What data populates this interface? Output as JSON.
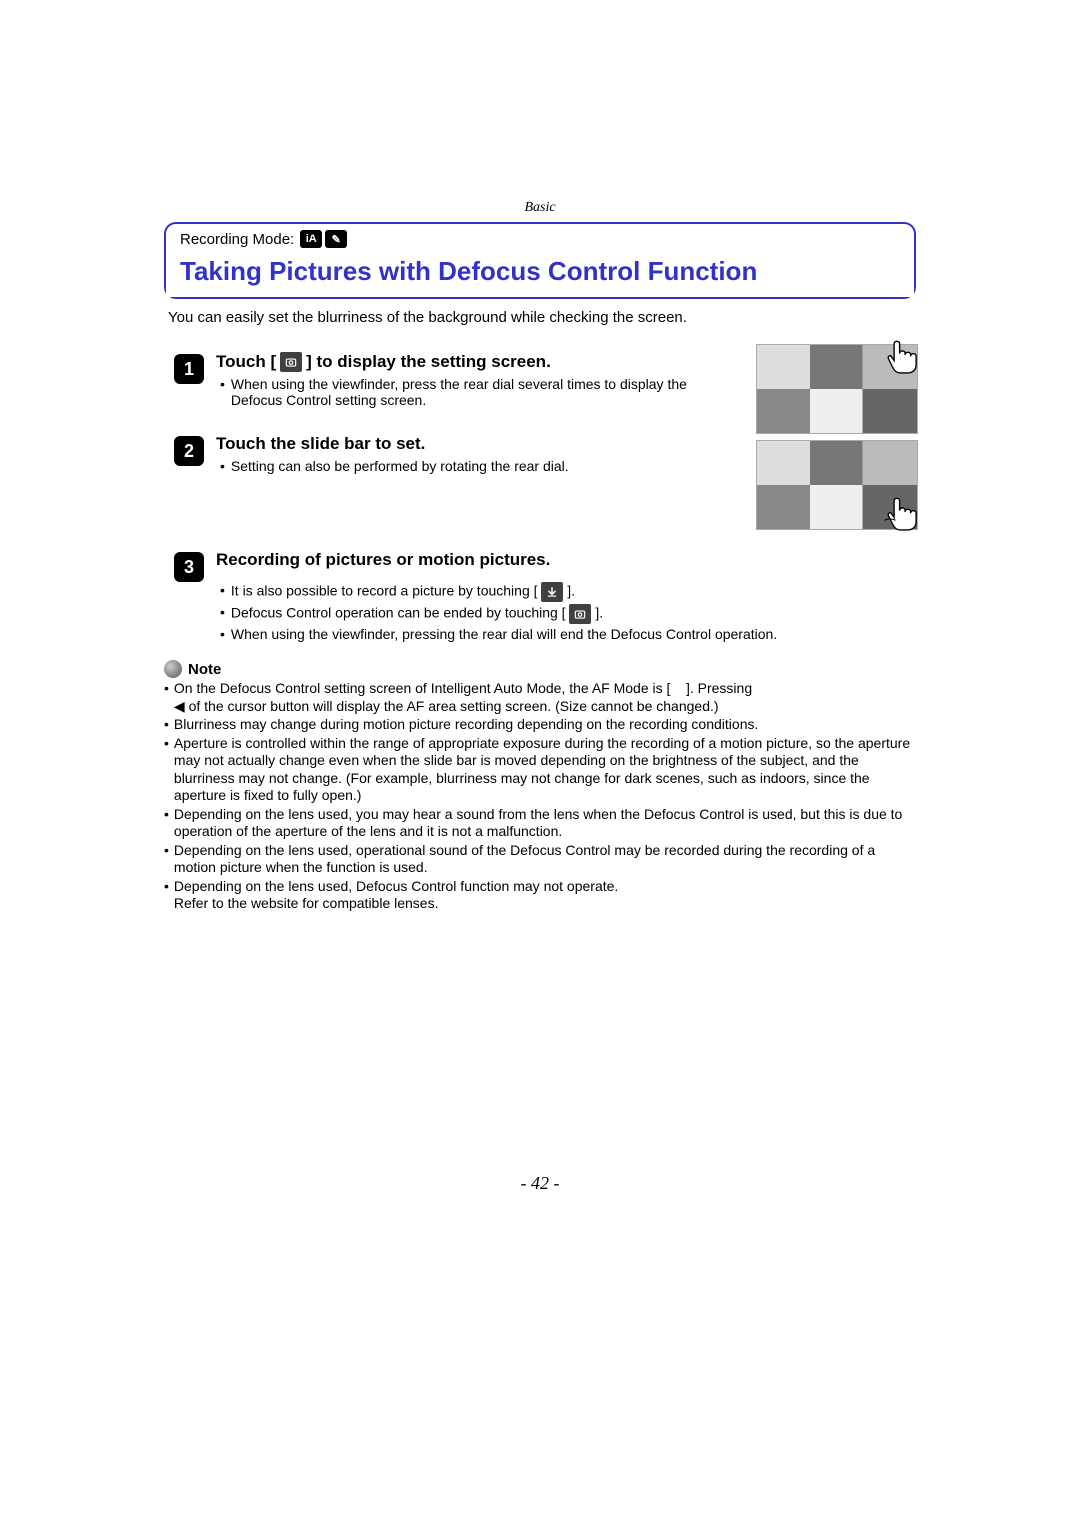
{
  "header_section": "Basic",
  "recording_mode_label": "Recording Mode:",
  "mode_icons": [
    "iA",
    "✎"
  ],
  "title": "Taking Pictures with Defocus Control Function",
  "intro": "You can easily set the blurriness of the background while checking the screen.",
  "steps": [
    {
      "num": "1",
      "title_pre": "Touch [",
      "title_post": "] to display the setting screen.",
      "bullets": [
        "When using the viewfinder, press the rear dial several times to display the Defocus Control setting screen."
      ]
    },
    {
      "num": "2",
      "title_pre": "Touch the slide bar to set.",
      "title_post": "",
      "bullets": [
        "Setting can also be performed by rotating the rear dial."
      ]
    },
    {
      "num": "3",
      "title_pre": "Recording of pictures or motion pictures.",
      "title_post": "",
      "bullets": [
        {
          "pre": "It is also possible to record a picture by touching [",
          "post": "].",
          "icon": "shutter-icon"
        },
        {
          "pre": "Defocus Control operation can be ended by touching [",
          "post": "].",
          "icon": "defocus-icon"
        },
        {
          "text": "When using the viewfinder, pressing the rear dial will end the Defocus Control operation."
        }
      ]
    }
  ],
  "note_label": "Note",
  "notes": [
    {
      "pre": "On the Defocus Control setting screen of Intelligent Auto Mode, the AF Mode is [",
      "post": "]. Pressing ",
      "tail": " of the cursor button will display the AF area setting screen. (Size cannot be changed.)",
      "arrow": "◀"
    },
    {
      "text": "Blurriness may change during motion picture recording depending on the recording conditions."
    },
    {
      "text": "Aperture is controlled within the range of appropriate exposure during the recording of a motion picture, so the aperture may not actually change even when the slide bar is moved depending on the brightness of the subject, and the blurriness may not change. (For example, blurriness may not change for dark scenes, such as indoors, since the aperture is fixed to fully open.)"
    },
    {
      "text": "Depending on the lens used, you may hear a sound from the lens when the Defocus Control is used, but this is due to operation of the aperture of the lens and it is not a malfunction."
    },
    {
      "text": "Depending on the lens used, operational sound of the Defocus Control may be recorded during the recording of a motion picture when the function is used."
    },
    {
      "text": "Depending on the lens used, Defocus Control function may not operate.\nRefer to the website for compatible lenses."
    }
  ],
  "page_number": "- 42 -"
}
